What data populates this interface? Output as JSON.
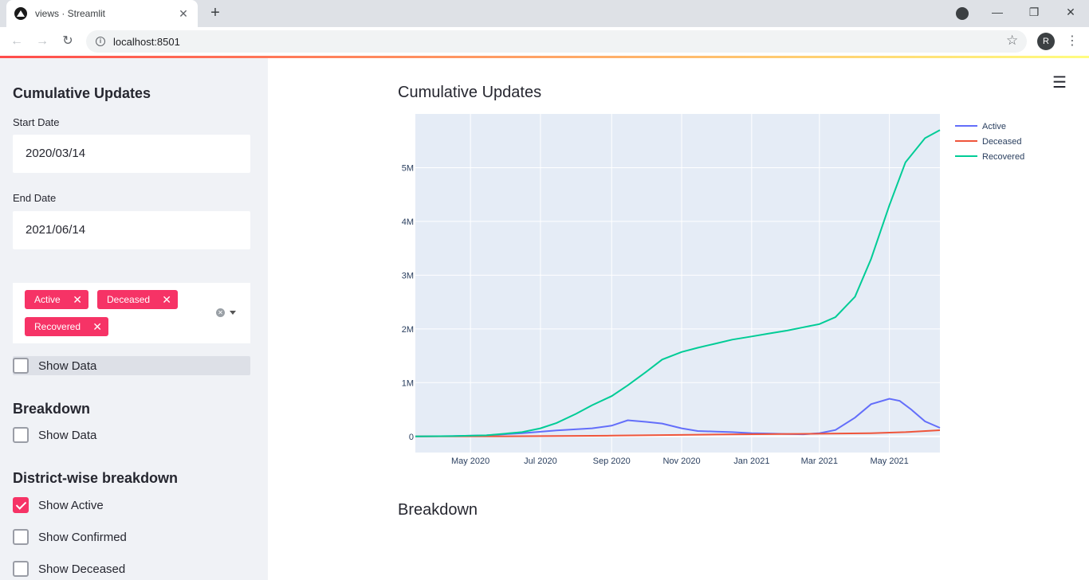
{
  "browser": {
    "tab_title": "views · Streamlit",
    "url": "localhost:8501",
    "avatar_letter": "R"
  },
  "sidebar": {
    "section1_title": "Cumulative Updates",
    "start_date_label": "Start Date",
    "start_date_value": "2020/03/14",
    "end_date_label": "End Date",
    "end_date_value": "2021/06/14",
    "chips": [
      "Active",
      "Deceased",
      "Recovered"
    ],
    "show_data_1": "Show Data",
    "section2_title": "Breakdown",
    "show_data_2": "Show Data",
    "section3_title": "District-wise breakdown",
    "show_active": "Show Active",
    "show_confirmed": "Show Confirmed",
    "show_deceased": "Show Deceased"
  },
  "main": {
    "title": "Cumulative Updates",
    "breakdown_title": "Breakdown"
  },
  "chart_data": {
    "type": "line",
    "x_ticks": [
      "May 2020",
      "Jul 2020",
      "Sep 2020",
      "Nov 2020",
      "Jan 2021",
      "Mar 2021",
      "May 2021"
    ],
    "y_ticks": [
      "0",
      "1M",
      "2M",
      "3M",
      "4M",
      "5M"
    ],
    "ylim": [
      -300000,
      6000000
    ],
    "xlim": [
      "2020-03-14",
      "2021-06-14"
    ],
    "series": [
      {
        "name": "Active",
        "color": "#636efa",
        "x": [
          "2020-03-14",
          "2020-04-15",
          "2020-05-15",
          "2020-06-15",
          "2020-07-15",
          "2020-08-15",
          "2020-09-01",
          "2020-09-15",
          "2020-10-01",
          "2020-10-15",
          "2020-11-01",
          "2020-11-15",
          "2020-12-01",
          "2020-12-15",
          "2021-01-01",
          "2021-01-15",
          "2021-02-01",
          "2021-02-15",
          "2021-03-01",
          "2021-03-15",
          "2021-04-01",
          "2021-04-15",
          "2021-05-01",
          "2021-05-10",
          "2021-05-20",
          "2021-06-01",
          "2021-06-14"
        ],
        "y": [
          0,
          5000,
          20000,
          60000,
          110000,
          150000,
          200000,
          300000,
          270000,
          240000,
          150000,
          100000,
          90000,
          80000,
          60000,
          55000,
          45000,
          40000,
          60000,
          120000,
          350000,
          600000,
          700000,
          660000,
          500000,
          280000,
          160000
        ]
      },
      {
        "name": "Deceased",
        "color": "#ef553b",
        "x": [
          "2020-03-14",
          "2020-06-01",
          "2020-09-01",
          "2020-12-01",
          "2021-03-01",
          "2021-04-15",
          "2021-05-15",
          "2021-06-14"
        ],
        "y": [
          0,
          3000,
          15000,
          35000,
          50000,
          60000,
          80000,
          115000
        ]
      },
      {
        "name": "Recovered",
        "color": "#00cc96",
        "x": [
          "2020-03-14",
          "2020-04-15",
          "2020-05-15",
          "2020-06-15",
          "2020-07-01",
          "2020-07-15",
          "2020-08-01",
          "2020-08-15",
          "2020-09-01",
          "2020-09-15",
          "2020-10-01",
          "2020-10-15",
          "2020-11-01",
          "2020-11-15",
          "2020-12-01",
          "2020-12-15",
          "2021-01-01",
          "2021-01-15",
          "2021-02-01",
          "2021-02-15",
          "2021-03-01",
          "2021-03-15",
          "2021-04-01",
          "2021-04-15",
          "2021-05-01",
          "2021-05-15",
          "2021-06-01",
          "2021-06-14"
        ],
        "y": [
          0,
          5000,
          20000,
          80000,
          150000,
          250000,
          420000,
          580000,
          750000,
          950000,
          1200000,
          1430000,
          1570000,
          1650000,
          1730000,
          1800000,
          1860000,
          1910000,
          1970000,
          2030000,
          2090000,
          2220000,
          2600000,
          3300000,
          4300000,
          5100000,
          5550000,
          5700000
        ]
      }
    ]
  }
}
